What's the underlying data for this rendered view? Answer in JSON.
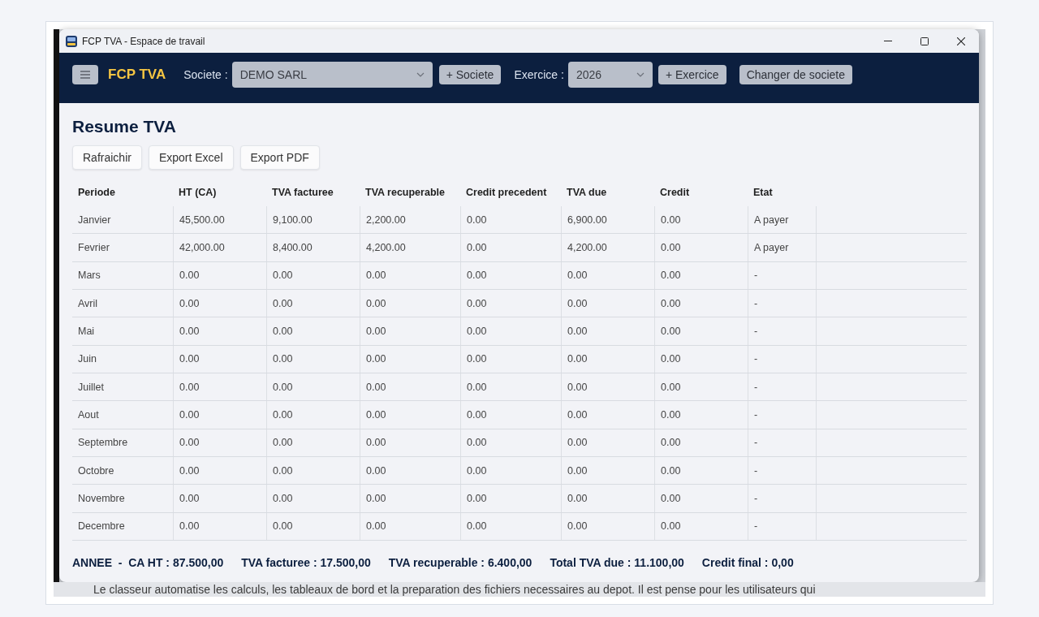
{
  "window": {
    "title": "FCP TVA - Espace de travail"
  },
  "header": {
    "brand": "FCP TVA",
    "company_label": "Societe :",
    "company_select": {
      "value": "DEMO SARL"
    },
    "add_company_button": "+ Societe",
    "year_label": "Exercice :",
    "year_select": {
      "value": "2026"
    },
    "add_year_button": "+ Exercice",
    "change_company_button": "Changer de societe"
  },
  "page": {
    "title": "Resume TVA",
    "actions": [
      "Rafraichir",
      "Export Excel",
      "Export PDF"
    ]
  },
  "table": {
    "columns": [
      "Periode",
      "HT (CA)",
      "TVA facturee",
      "TVA recuperable",
      "Credit precedent",
      "TVA due",
      "Credit",
      "Etat"
    ],
    "rows": [
      {
        "cells": [
          "Janvier",
          "45,500.00",
          "9,100.00",
          "2,200.00",
          "0.00",
          "6,900.00",
          "0.00",
          "A payer"
        ]
      },
      {
        "cells": [
          "Fevrier",
          "42,000.00",
          "8,400.00",
          "4,200.00",
          "0.00",
          "4,200.00",
          "0.00",
          "A payer"
        ]
      },
      {
        "cells": [
          "Mars",
          "0.00",
          "0.00",
          "0.00",
          "0.00",
          "0.00",
          "0.00",
          "-"
        ]
      },
      {
        "cells": [
          "Avril",
          "0.00",
          "0.00",
          "0.00",
          "0.00",
          "0.00",
          "0.00",
          "-"
        ]
      },
      {
        "cells": [
          "Mai",
          "0.00",
          "0.00",
          "0.00",
          "0.00",
          "0.00",
          "0.00",
          "-"
        ]
      },
      {
        "cells": [
          "Juin",
          "0.00",
          "0.00",
          "0.00",
          "0.00",
          "0.00",
          "0.00",
          "-"
        ]
      },
      {
        "cells": [
          "Juillet",
          "0.00",
          "0.00",
          "0.00",
          "0.00",
          "0.00",
          "0.00",
          "-"
        ]
      },
      {
        "cells": [
          "Aout",
          "0.00",
          "0.00",
          "0.00",
          "0.00",
          "0.00",
          "0.00",
          "-"
        ]
      },
      {
        "cells": [
          "Septembre",
          "0.00",
          "0.00",
          "0.00",
          "0.00",
          "0.00",
          "0.00",
          "-"
        ]
      },
      {
        "cells": [
          "Octobre",
          "0.00",
          "0.00",
          "0.00",
          "0.00",
          "0.00",
          "0.00",
          "-"
        ]
      },
      {
        "cells": [
          "Novembre",
          "0.00",
          "0.00",
          "0.00",
          "0.00",
          "0.00",
          "0.00",
          "-"
        ]
      },
      {
        "cells": [
          "Decembre",
          "0.00",
          "0.00",
          "0.00",
          "0.00",
          "0.00",
          "0.00",
          "-"
        ]
      }
    ]
  },
  "totals": [
    "ANNEE  -  CA HT : 87.500,00",
    "TVA facturee : 17.500,00",
    "TVA recuperable : 6.400,00",
    "Total TVA due : 11.100,00",
    "Credit final : 0,00"
  ],
  "background_text": "Le classeur automatise les calculs, les tableaux de bord et la preparation des fichiers necessaires au depot. Il est pense pour les utilisateurs qui"
}
